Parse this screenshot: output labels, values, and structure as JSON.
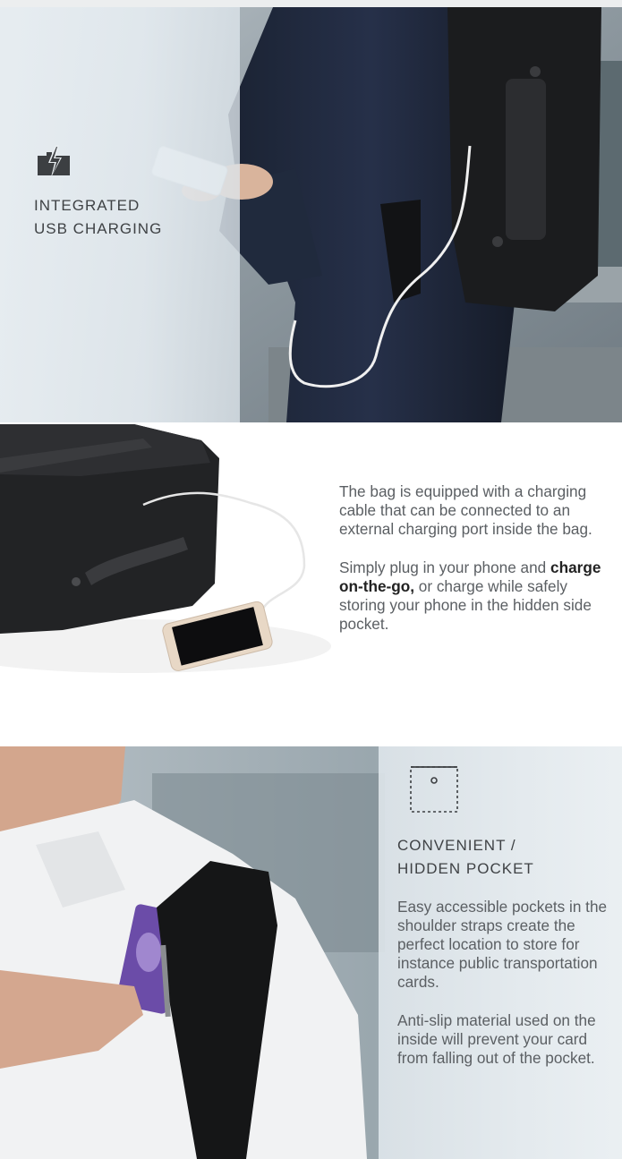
{
  "charging_section": {
    "icon": "charging-bolt-icon",
    "heading_line1": "INTEGRATED",
    "heading_line2": "USB CHARGING"
  },
  "description_section": {
    "paragraph1": "The bag is equipped with a charging cable that can be connected to an external charging port inside the bag.",
    "paragraph2_before": "Simply plug in your phone and ",
    "paragraph2_bold": "charge on-the-go,",
    "paragraph2_after": " or charge while safely storing your phone in the hidden side pocket."
  },
  "pocket_section": {
    "icon": "pocket-icon",
    "heading_line1": "CONVENIENT /",
    "heading_line2": "HIDDEN POCKET",
    "paragraph1": "Easy accessible pockets in the shoulder straps create the perfect location to store for instance public transportation cards.",
    "paragraph2": "Anti-slip material used on the inside will prevent your card from falling out of the pocket."
  },
  "colors": {
    "heading_text": "#3f4245",
    "body_text": "#5b5f63",
    "panel_overlay": "#e6ecf0"
  }
}
